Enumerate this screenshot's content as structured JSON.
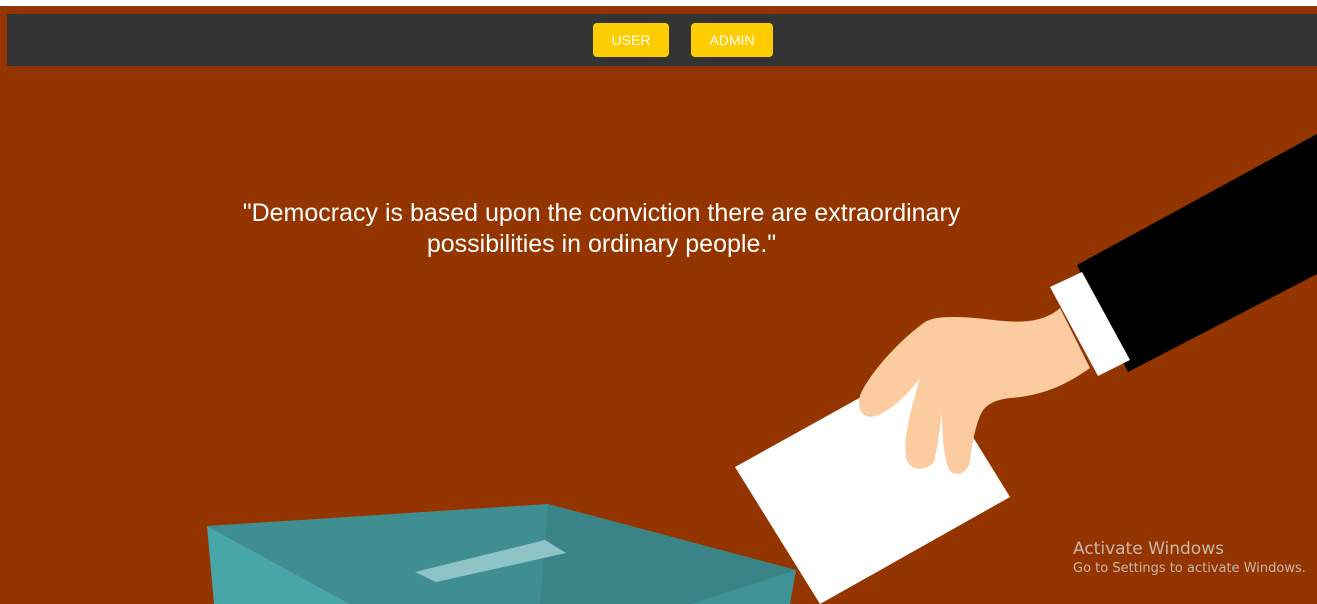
{
  "nav": {
    "user_label": "USER",
    "admin_label": "ADMIN"
  },
  "hero": {
    "quote": "\"Democracy is based upon the conviction there are extraordinary possibilities in ordinary people.\""
  },
  "watermark": {
    "title": "Activate Windows",
    "subtitle": "Go to Settings to activate Windows."
  },
  "colors": {
    "hero_background": "#943500",
    "navbar_background": "#333333",
    "button_background": "#ffcc00",
    "ballot_box": "#3f8f92",
    "hand_skin": "#fccb9f",
    "sleeve": "#000000"
  },
  "illustration": {
    "icon": "ballot-voting-illustration"
  }
}
